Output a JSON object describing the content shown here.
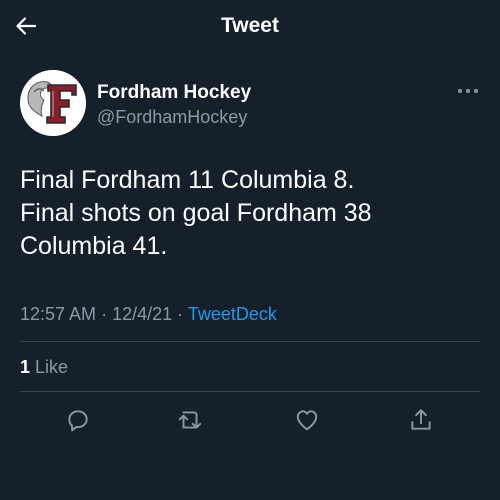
{
  "header": {
    "title": "Tweet",
    "back_icon": "arrow-left-icon"
  },
  "author": {
    "display_name": "Fordham Hockey",
    "handle": "@FordhamHockey",
    "avatar_icon": "fordham-ram-logo",
    "more_icon": "more-horizontal-icon"
  },
  "tweet": {
    "lines": [
      "Final Fordham 11 Columbia 8.",
      "Final shots on goal Fordham 38",
      "Columbia 41."
    ]
  },
  "meta": {
    "time": "12:57 AM",
    "separator": "·",
    "date": "12/4/21",
    "source": "TweetDeck"
  },
  "stats": {
    "likes_count": "1",
    "likes_label": "Like"
  },
  "actions": {
    "reply_icon": "reply-icon",
    "retweet_icon": "retweet-icon",
    "like_icon": "heart-icon",
    "share_icon": "share-icon"
  },
  "colors": {
    "background": "#15202b",
    "text_primary": "#ffffff",
    "text_secondary": "#8b98a5",
    "link": "#1d9bf0",
    "divider": "#38444d",
    "brand_maroon": "#8a1c2b"
  }
}
